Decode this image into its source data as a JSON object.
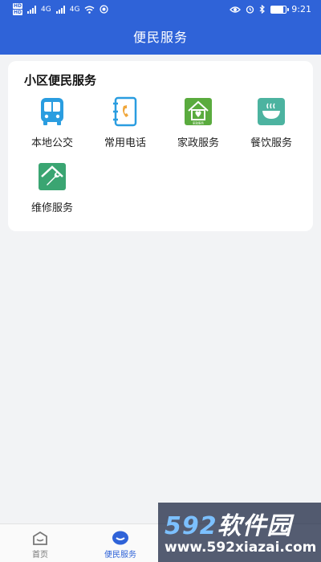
{
  "status_bar": {
    "network_left": "HD",
    "network_right": "HD",
    "net_1": "4G",
    "net_2": "4G",
    "time": "9:21",
    "battery_level": 0.8
  },
  "header": {
    "title": "便民服务"
  },
  "section": {
    "title": "小区便民服务",
    "items": [
      {
        "label": "本地公交",
        "icon": "bus-icon",
        "color": "#2a9de0"
      },
      {
        "label": "常用电话",
        "icon": "phone-book-icon",
        "color": "#2a9de0"
      },
      {
        "label": "家政服务",
        "icon": "housekeeping-icon",
        "color": "#5aab3e",
        "icon_caption": "家政服务"
      },
      {
        "label": "餐饮服务",
        "icon": "bowl-icon",
        "color": "#4cb3a0"
      },
      {
        "label": "维修服务",
        "icon": "repair-icon",
        "color": "#3aa572"
      }
    ]
  },
  "tabbar": {
    "tabs": [
      {
        "label": "首页",
        "icon": "home-icon",
        "active": false
      },
      {
        "label": "便民服务",
        "icon": "chat-icon",
        "active": true
      }
    ],
    "active_color": "#2f63d8"
  },
  "watermark": {
    "logo_num": "592",
    "logo_text": "软件园",
    "url": "www.592xiazai.com"
  },
  "colors": {
    "primary": "#2f63d8",
    "background": "#f2f3f5"
  }
}
